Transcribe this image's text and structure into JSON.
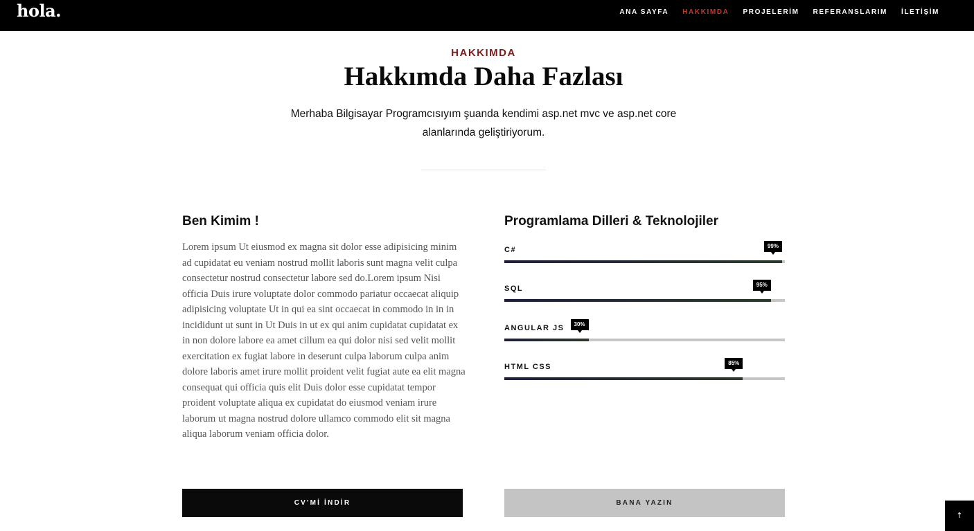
{
  "header": {
    "logo": "hola.",
    "nav": [
      {
        "label": "ANA SAYFA",
        "active": false
      },
      {
        "label": "HAKKIMDA",
        "active": true
      },
      {
        "label": "PROJELERİM",
        "active": false
      },
      {
        "label": "REFERANSLARIM",
        "active": false
      },
      {
        "label": "İLETİŞİM",
        "active": false
      }
    ]
  },
  "section": {
    "label": "HAKKIMDA",
    "title": "Hakkımda Daha Fazlası",
    "intro": "Merhaba Bilgisayar Programcısıyım şuanda kendimi asp.net mvc ve asp.net core alanlarında geliştiriyorum."
  },
  "about": {
    "title": "Ben Kimim !",
    "text": "Lorem ipsum Ut eiusmod ex magna sit dolor esse adipisicing minim ad cupidatat eu veniam nostrud mollit laboris sunt magna velit culpa consectetur nostrud consectetur labore sed do.Lorem ipsum Nisi officia Duis irure voluptate dolor commodo pariatur occaecat aliquip adipisicing voluptate Ut in qui ea sint occaecat in commodo in in in incididunt ut sunt in Ut Duis in ut ex qui anim cupidatat cupidatat ex in non dolore labore ea amet cillum ea qui dolor nisi sed velit mollit exercitation ex fugiat labore in deserunt culpa laborum culpa anim dolore laboris amet irure mollit proident velit fugiat aute ea elit magna consequat qui officia quis elit Duis dolor esse cupidatat tempor proident voluptate aliqua ex cupidatat do eiusmod veniam irure laborum ut magna nostrud dolore ullamco commodo elit sit magna aliqua laborum veniam officia dolor."
  },
  "skills": {
    "title": "Programlama Dilleri & Teknolojiler",
    "items": [
      {
        "name": "C#",
        "percent": 99,
        "label": "99%"
      },
      {
        "name": "SQL",
        "percent": 95,
        "label": "95%"
      },
      {
        "name": "ANGULAR JS",
        "percent": 30,
        "label": "30%"
      },
      {
        "name": "HTML CSS",
        "percent": 85,
        "label": "85%"
      }
    ]
  },
  "buttons": {
    "cv": "CV'Mİ İNDİR",
    "contact": "BANA YAZIN"
  },
  "back_to_top": "↑",
  "colors": {
    "accent": "#c0392b",
    "label": "#7c1d1d",
    "bar_track": "#c6c6c6",
    "bar_fill": "#1e1e3a"
  }
}
